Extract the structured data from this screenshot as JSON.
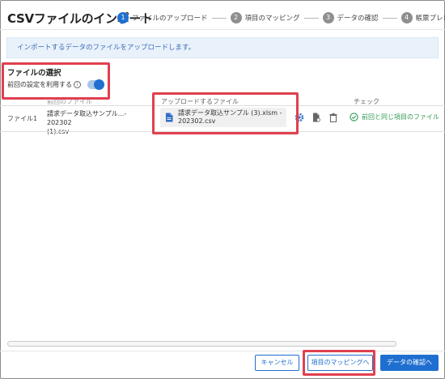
{
  "dialog": {
    "title": "CSVファイルのインポート"
  },
  "steps": [
    {
      "num": "1",
      "label": "ファイルのアップロード",
      "active": true
    },
    {
      "num": "2",
      "label": "項目のマッピング",
      "active": false
    },
    {
      "num": "3",
      "label": "データの確認",
      "active": false
    },
    {
      "num": "4",
      "label": "帳票プレビュー",
      "active": false
    }
  ],
  "info_banner": "インポートするデータのファイルをアップロードします。",
  "file_section": {
    "title": "ファイルの選択",
    "reuse_label": "前回の設定を利用する",
    "reuse_info_icon": "info-icon",
    "reuse_enabled": true
  },
  "table": {
    "columns": [
      "前回のファイル",
      "アップロードするファイル",
      "チェック"
    ],
    "rows": [
      {
        "label": "ファイル1",
        "previous_file_line1": "請求データ取込サンプル...- 202302",
        "previous_file_line2": "(1).csv",
        "upload_file_line1": "請求データ取込サンプル (3).xlsm -",
        "upload_file_line2": "202302.csv",
        "actions": [
          "settings-icon",
          "file-replace-icon",
          "trash-icon"
        ],
        "check_text": "前回と同じ項目のファイル"
      }
    ]
  },
  "buttons": {
    "cancel": "キャンセル",
    "mapping": "項目のマッピングへ",
    "confirm": "データの確認へ"
  },
  "colors": {
    "accent": "#1f6fd1",
    "success": "#2e9a55",
    "highlight": "#e0404f",
    "info_bg": "#e9f1fb"
  }
}
